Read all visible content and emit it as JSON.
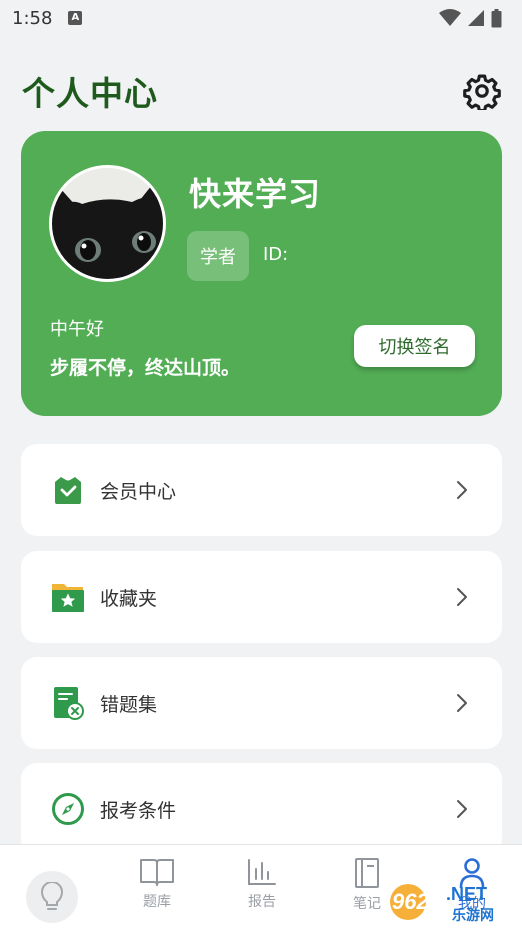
{
  "status_bar": {
    "time": "1:58",
    "notification_glyph": "A"
  },
  "header": {
    "title": "个人中心",
    "settings_icon": "gear-icon"
  },
  "profile": {
    "name": "快来学习",
    "role": "学者",
    "id_label": "ID:",
    "greeting": "中午好",
    "motto": "步履不停，终达山顶。",
    "switch_button": "切换签名"
  },
  "menu": [
    {
      "label": "会员中心",
      "icon": "shield-check-icon"
    },
    {
      "label": "收藏夹",
      "icon": "star-folder-icon"
    },
    {
      "label": "错题集",
      "icon": "wrong-questions-icon"
    },
    {
      "label": "报考条件",
      "icon": "compass-icon"
    }
  ],
  "bottom_nav": {
    "items": [
      {
        "label": "",
        "icon": "lightbulb-icon"
      },
      {
        "label": "题库",
        "icon": "book-icon"
      },
      {
        "label": "报告",
        "icon": "bar-chart-icon"
      },
      {
        "label": "笔记",
        "icon": "notebook-icon"
      },
      {
        "label": "我的",
        "icon": "person-icon"
      }
    ]
  },
  "watermark": {
    "brand": "962",
    "suffix": "NET",
    "subtitle": "乐游网"
  },
  "colors": {
    "primary": "#52ad55",
    "title": "#1f5a1d",
    "background": "#f1f2f4"
  }
}
